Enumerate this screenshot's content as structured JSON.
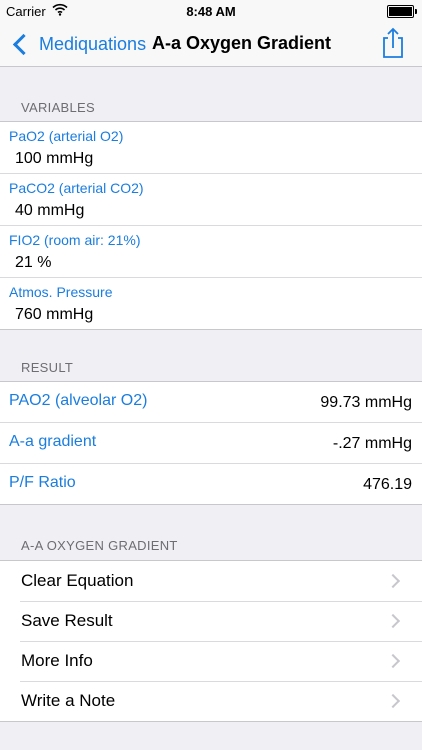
{
  "status_bar": {
    "carrier": "Carrier",
    "time": "8:48 AM",
    "battery_percent": 100
  },
  "nav": {
    "back_label": "Mediquations",
    "title": "A-a Oxygen Gradient",
    "share_icon": "share-icon"
  },
  "variables": {
    "header": "VARIABLES",
    "items": [
      {
        "label": "PaO2 (arterial O2)",
        "value": "100 mmHg"
      },
      {
        "label": "PaCO2 (arterial CO2)",
        "value": "40 mmHg"
      },
      {
        "label": "FIO2 (room air: 21%)",
        "value": "21 %"
      },
      {
        "label": "Atmos. Pressure",
        "value": "760 mmHg"
      }
    ]
  },
  "result": {
    "header": "RESULT",
    "items": [
      {
        "label": "PAO2 (alveolar O2)",
        "value": "99.73 mmHg"
      },
      {
        "label": "A-a gradient",
        "value": "-.27 mmHg"
      },
      {
        "label": "P/F Ratio",
        "value": "476.19"
      }
    ]
  },
  "actions": {
    "header": "A-A OXYGEN GRADIENT",
    "items": [
      {
        "label": "Clear Equation"
      },
      {
        "label": "Save Result"
      },
      {
        "label": "More Info"
      },
      {
        "label": "Write a Note"
      }
    ]
  },
  "colors": {
    "accent": "#1a7ddf",
    "background": "#efeff4",
    "header_text": "#6d6d72"
  }
}
